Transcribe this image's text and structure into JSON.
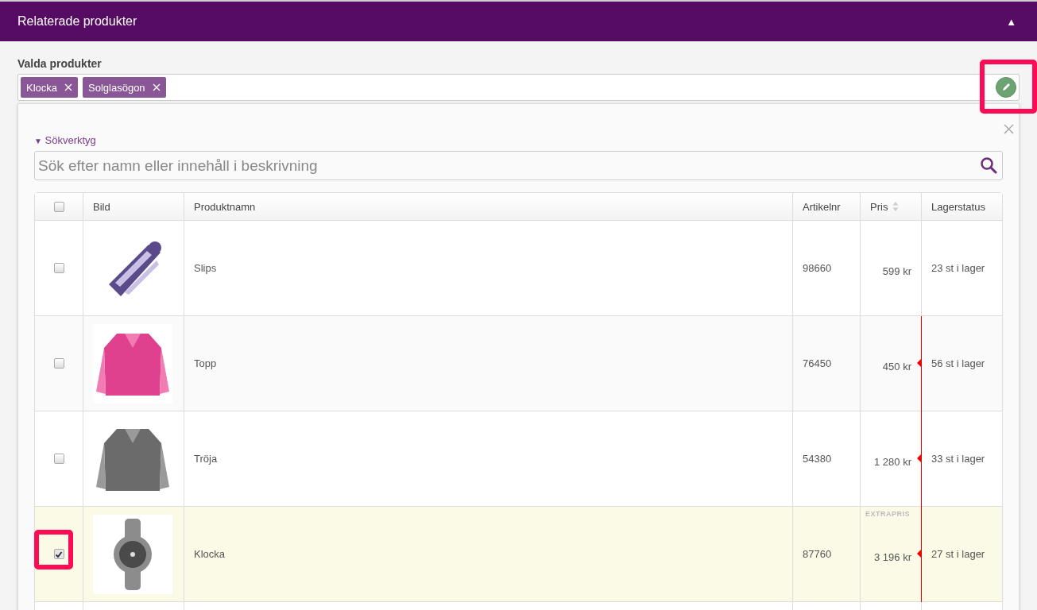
{
  "section": {
    "title": "Relaterade produkter",
    "toggle": "▲"
  },
  "selected_products": {
    "label": "Valda produkter",
    "tags": [
      "Klocka",
      "Solglasögon"
    ],
    "edit_highlighted": true
  },
  "search_tools": {
    "toggle": "▼",
    "label": "Sökverktyg",
    "placeholder": "Sök efter namn eller innehåll i beskrivning"
  },
  "table": {
    "select_all_checked": false,
    "columns": [
      "Bild",
      "Produktnamn",
      "Artikelnr",
      "Pris",
      "Lagerstatus"
    ],
    "rows": [
      {
        "checked": false,
        "highlighted": false,
        "selected": false,
        "name": "Slips",
        "article": "98660",
        "price": "599 kr",
        "stock": "23 st i lager",
        "marked": false
      },
      {
        "checked": false,
        "highlighted": false,
        "selected": false,
        "name": "Topp",
        "article": "76450",
        "price": "450 kr",
        "stock": "56 st i lager",
        "marked": true
      },
      {
        "checked": false,
        "highlighted": false,
        "selected": false,
        "name": "Tröja",
        "article": "54380",
        "price": "1 280 kr",
        "stock": "33 st i lager",
        "marked": true
      },
      {
        "checked": true,
        "highlighted": true,
        "selected": true,
        "name": "Klocka",
        "article": "87760",
        "price_label": "EXTRAPRIS",
        "price": "3 196 kr",
        "stock": "27 st i lager",
        "marked": true
      }
    ]
  }
}
